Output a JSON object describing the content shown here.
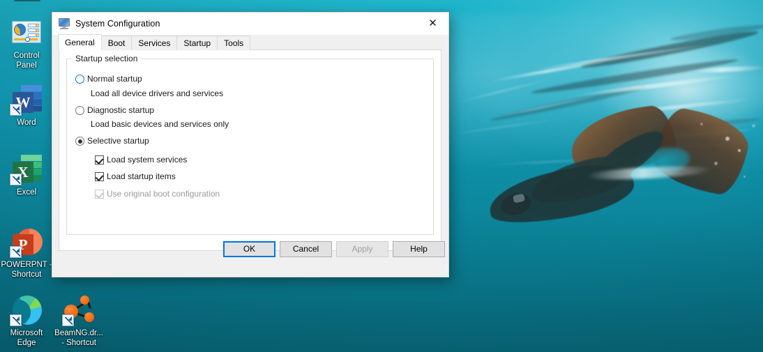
{
  "desktop": {
    "wallpaper_description": "Underwater photo of a freediver in a monofin silhouetted against turquoise water with sunlight streaks at the surface",
    "wallpaper_colors": {
      "shallow": "#1fb6cc",
      "mid": "#0f93ab",
      "deep": "#0a7486",
      "fin_brown": "#96643c",
      "diver_silhouette": "#1e3436"
    },
    "icons": [
      {
        "name": "control-panel",
        "label_lines": [
          "Control",
          "Panel"
        ],
        "shortcut": false
      },
      {
        "name": "word",
        "label_lines": [
          "Word"
        ],
        "glyph": "W",
        "shortcut": true
      },
      {
        "name": "excel",
        "label_lines": [
          "Excel"
        ],
        "glyph": "X",
        "shortcut": true
      },
      {
        "name": "powerpoint",
        "label_lines": [
          "POWERPNT -",
          "Shortcut"
        ],
        "glyph": "P",
        "shortcut": true
      },
      {
        "name": "microsoft-edge",
        "label_lines": [
          "Microsoft",
          "Edge"
        ],
        "shortcut": true
      },
      {
        "name": "beamng-drive",
        "label_lines": [
          "BeamNG.dr...",
          "- Shortcut"
        ],
        "shortcut": true
      }
    ]
  },
  "dialog": {
    "title": "System Configuration",
    "icon": "computer-monitor-icon",
    "close_glyph": "✕",
    "tabs": [
      {
        "label": "General",
        "active": true
      },
      {
        "label": "Boot",
        "active": false
      },
      {
        "label": "Services",
        "active": false
      },
      {
        "label": "Startup",
        "active": false
      },
      {
        "label": "Tools",
        "active": false
      }
    ],
    "group": {
      "legend": "Startup selection",
      "options": [
        {
          "name": "normal-startup",
          "label": "Normal startup",
          "description": "Load all device drivers and services",
          "selected": false,
          "hover": true
        },
        {
          "name": "diagnostic-startup",
          "label": "Diagnostic startup",
          "description": "Load basic devices and services only",
          "selected": false,
          "hover": false
        },
        {
          "name": "selective-startup",
          "label": "Selective startup",
          "description": "",
          "selected": true,
          "hover": false
        }
      ],
      "checkboxes": [
        {
          "name": "load-system-services",
          "label": "Load system services",
          "checked": true,
          "disabled": false
        },
        {
          "name": "load-startup-items",
          "label": "Load startup items",
          "checked": true,
          "disabled": false
        },
        {
          "name": "use-original-boot-config",
          "label": "Use original boot configuration",
          "checked": true,
          "disabled": true
        }
      ]
    },
    "buttons": [
      {
        "name": "ok",
        "label": "OK",
        "default": true,
        "disabled": false
      },
      {
        "name": "cancel",
        "label": "Cancel",
        "default": false,
        "disabled": false
      },
      {
        "name": "apply",
        "label": "Apply",
        "default": false,
        "disabled": true
      },
      {
        "name": "help",
        "label": "Help",
        "default": false,
        "disabled": false
      }
    ],
    "accent_color": "#0078d7"
  }
}
